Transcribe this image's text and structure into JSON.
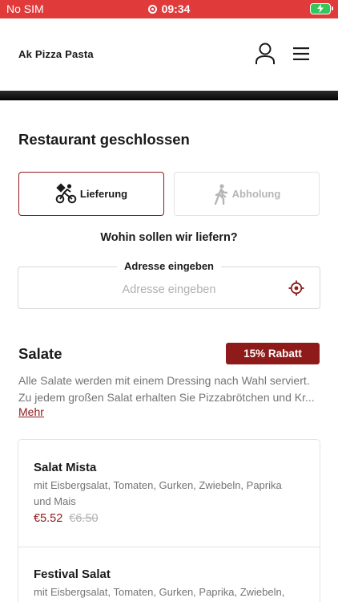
{
  "status_bar": {
    "carrier": "No SIM",
    "time": "09:34",
    "background": "#e03a3a",
    "battery_color": "#34c759"
  },
  "header": {
    "brand": "Ak Pizza Pasta",
    "icons": [
      "user-icon",
      "menu-icon"
    ]
  },
  "restaurant_status": "Restaurant geschlossen",
  "order_type": {
    "selected": "delivery",
    "delivery_label": "Lieferung",
    "pickup_label": "Abholung",
    "accent": "#8e1a1a"
  },
  "address": {
    "question": "Wohin sollen wir liefern?",
    "legend": "Adresse eingeben",
    "placeholder": "Adresse eingeben",
    "value": ""
  },
  "category": {
    "title": "Salate",
    "discount_badge": "15% Rabatt",
    "description_line1": "Alle Salate werden mit einem Dressing nach Wahl serviert.",
    "description_line2": "Zu jedem großen Salat erhalten Sie Pizzabrötchen und Kr...",
    "more_link": "Mehr"
  },
  "items": [
    {
      "name": "Salat Mista",
      "description": "mit Eisbergsalat, Tomaten, Gurken, Zwiebeln, Paprika und Mais",
      "price": "€5.52",
      "old_price": "€6.50"
    },
    {
      "name": "Festival Salat",
      "description": "mit Eisbergsalat, Tomaten, Gurken, Paprika, Zwiebeln,"
    }
  ]
}
